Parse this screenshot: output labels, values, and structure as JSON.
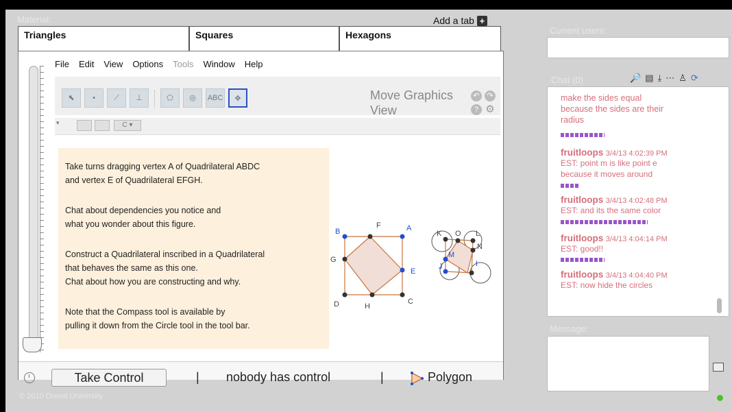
{
  "material_label": "Material:",
  "add_tab_label": "Add a tab",
  "tabs": [
    {
      "label": "Triangles"
    },
    {
      "label": "Squares"
    },
    {
      "label": "Hexagons"
    }
  ],
  "menu": [
    "File",
    "Edit",
    "View",
    "Options",
    "Tools",
    "Window",
    "Help"
  ],
  "tool_title": {
    "line1": "Move Graphics",
    "line2": "View"
  },
  "tool_text": "ABC",
  "instructions": [
    "Take turns dragging vertex A of Quadrilateral ABDC",
    "and vertex E of Quadrilateral EFGH.",
    "Chat about dependencies you notice and",
    "what you wonder about this figure.",
    "Construct a Quadrilateral inscribed in a Quadrilateral",
    "that behaves the same as this one.",
    "Chat about how you are constructing and why.",
    "Note that the Compass tool is available by",
    "pulling it down from the Circle tool in the tool bar."
  ],
  "points": {
    "square": [
      "B",
      "F",
      "A",
      "G",
      "E",
      "D",
      "H",
      "C"
    ],
    "small": [
      "K",
      "O",
      "L",
      "N",
      "M",
      "J",
      "I"
    ]
  },
  "status": {
    "take_control": "Take Control",
    "separator": "|",
    "control_text": "nobody has control",
    "current_tool": "Polygon"
  },
  "copyright": "© 2010 Drexel University",
  "current_users_label": "Current users:",
  "chat_label": "Chat (0)",
  "chat_lines": [
    {
      "text": "make the sides equal"
    },
    {
      "text": "because the sides are their"
    },
    {
      "text": "radius"
    }
  ],
  "chat_messages": [
    {
      "user": "fruitloops",
      "time": "3/4/13 4:02:39 PM",
      "lines": [
        "EST: point m is like point e",
        "because it moves around"
      ]
    },
    {
      "user": "fruitloops",
      "time": "3/4/13 4:02:48 PM",
      "lines": [
        "EST: and its the same color"
      ]
    },
    {
      "user": "fruitloops",
      "time": "3/4/13 4:04:14 PM",
      "lines": [
        "EST: good!!"
      ]
    },
    {
      "user": "fruitloops",
      "time": "3/4/13 4:04:40 PM",
      "lines": [
        "EST: now hide the circles"
      ]
    }
  ],
  "message_label": "Message:",
  "colors": {
    "chat_text": "#d56f7a",
    "separator": "#9a55c9",
    "point_blue": "#1f4fd6",
    "point_dark": "#333333",
    "shape_fill": "#f1ded6",
    "shape_edge": "#c8743d",
    "status_ok": "#4fbf2a"
  }
}
